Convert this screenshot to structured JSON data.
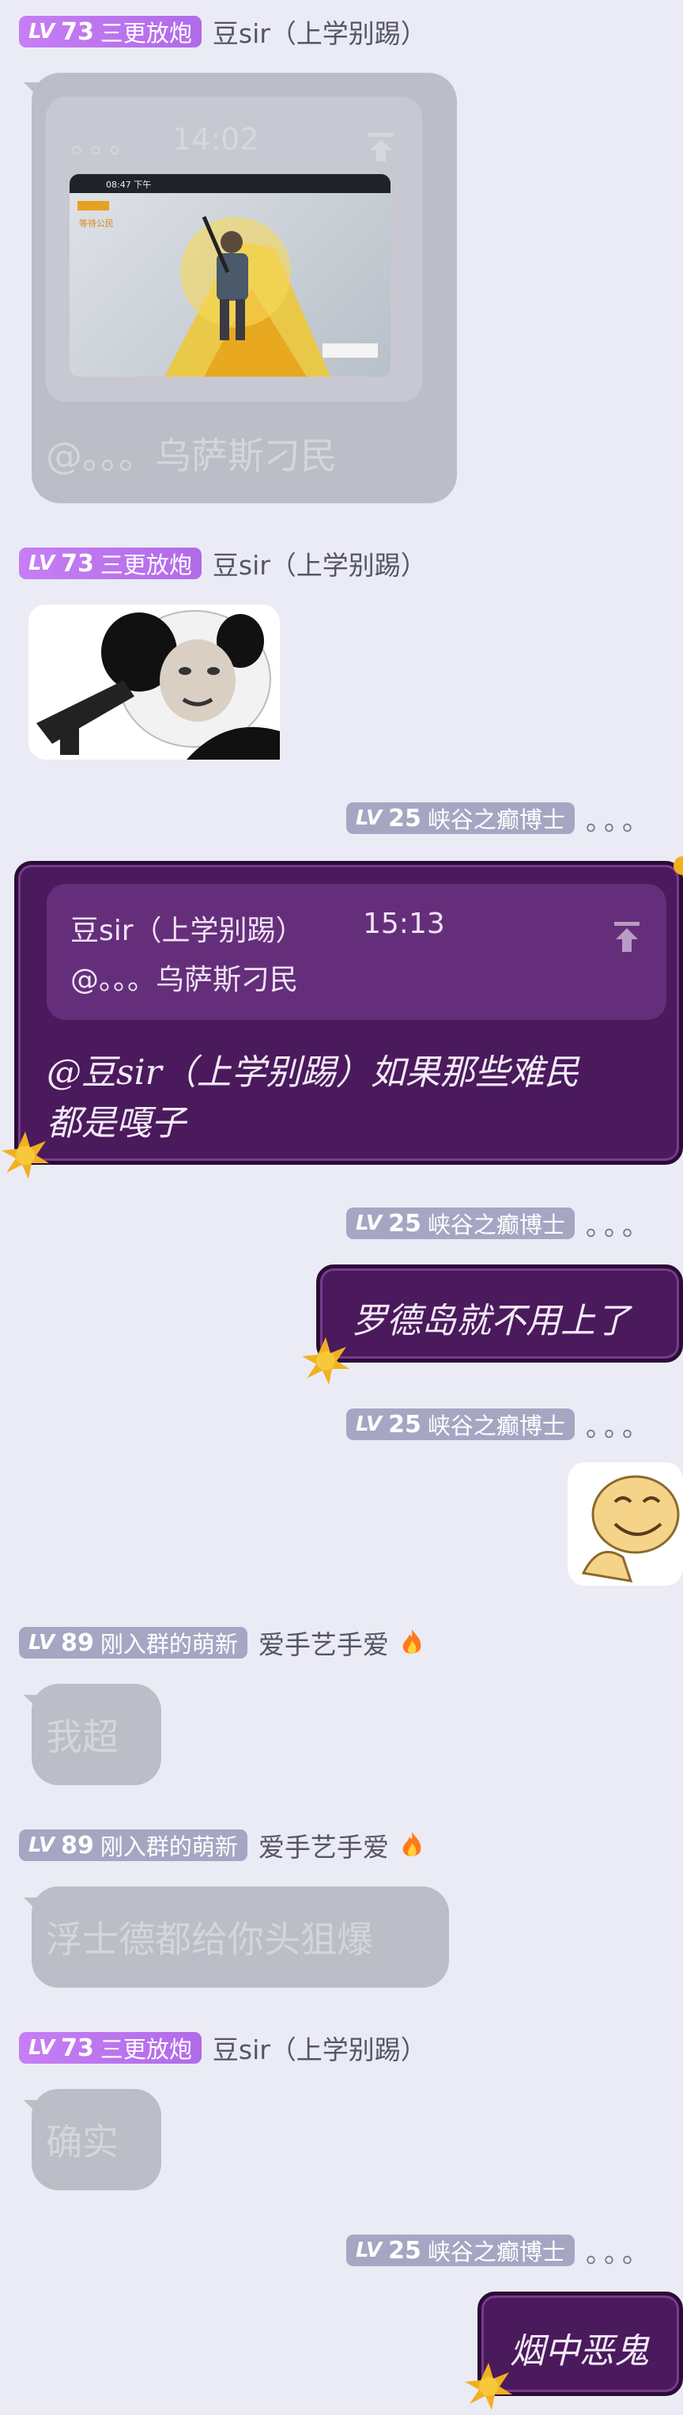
{
  "messages": {
    "m1": {
      "badge_lv": "LV",
      "badge_num": "73",
      "badge_title": "三更放炮",
      "sender": "豆sir（上学别踢）",
      "card_time": "14:02",
      "card_dots": "。。。",
      "mention": "@。。。乌萨斯刁民",
      "shot": {
        "header_text": "08:47 下午",
        "left_tag": "等待公民"
      }
    },
    "m2": {
      "badge_lv": "LV",
      "badge_num": "73",
      "badge_title": "三更放炮",
      "sender": "豆sir（上学别踢）"
    },
    "m3": {
      "badge_lv": "LV",
      "badge_num": "25",
      "badge_title": "峡谷之癫博士",
      "dots": "。。。",
      "quote_sender": "豆sir（上学别踢）",
      "quote_time": "15:13",
      "quote_text": "@。。。乌萨斯刁民",
      "text_line1": "@豆sir（上学别踢）如果那些难民",
      "text_line2": "都是嘎子"
    },
    "m4": {
      "badge_lv": "LV",
      "badge_num": "25",
      "badge_title": "峡谷之癫博士",
      "dots": "。。。",
      "text": "罗德岛就不用上了"
    },
    "m5": {
      "badge_lv": "LV",
      "badge_num": "25",
      "badge_title": "峡谷之癫博士",
      "dots": "。。。"
    },
    "m6": {
      "badge_lv": "LV",
      "badge_num": "89",
      "badge_title": "刚入群的萌新",
      "sender": "爱手艺手爱",
      "text": "我超"
    },
    "m7": {
      "badge_lv": "LV",
      "badge_num": "89",
      "badge_title": "刚入群的萌新",
      "sender": "爱手艺手爱",
      "text": "浮士德都给你头狙爆"
    },
    "m8": {
      "badge_lv": "LV",
      "badge_num": "73",
      "badge_title": "三更放炮",
      "sender": "豆sir（上学别踢）",
      "text": "确实"
    },
    "m9": {
      "badge_lv": "LV",
      "badge_num": "25",
      "badge_title": "峡谷之癫博士",
      "dots": "。。。",
      "text": "烟中恶鬼"
    }
  },
  "colors": {
    "background": "#ebebf5",
    "badge_purple": "#c77ef4",
    "badge_gray": "#a6a6c3",
    "bubble_gray": "#bdbdc8",
    "bubble_purple": "#4a1a5c"
  }
}
